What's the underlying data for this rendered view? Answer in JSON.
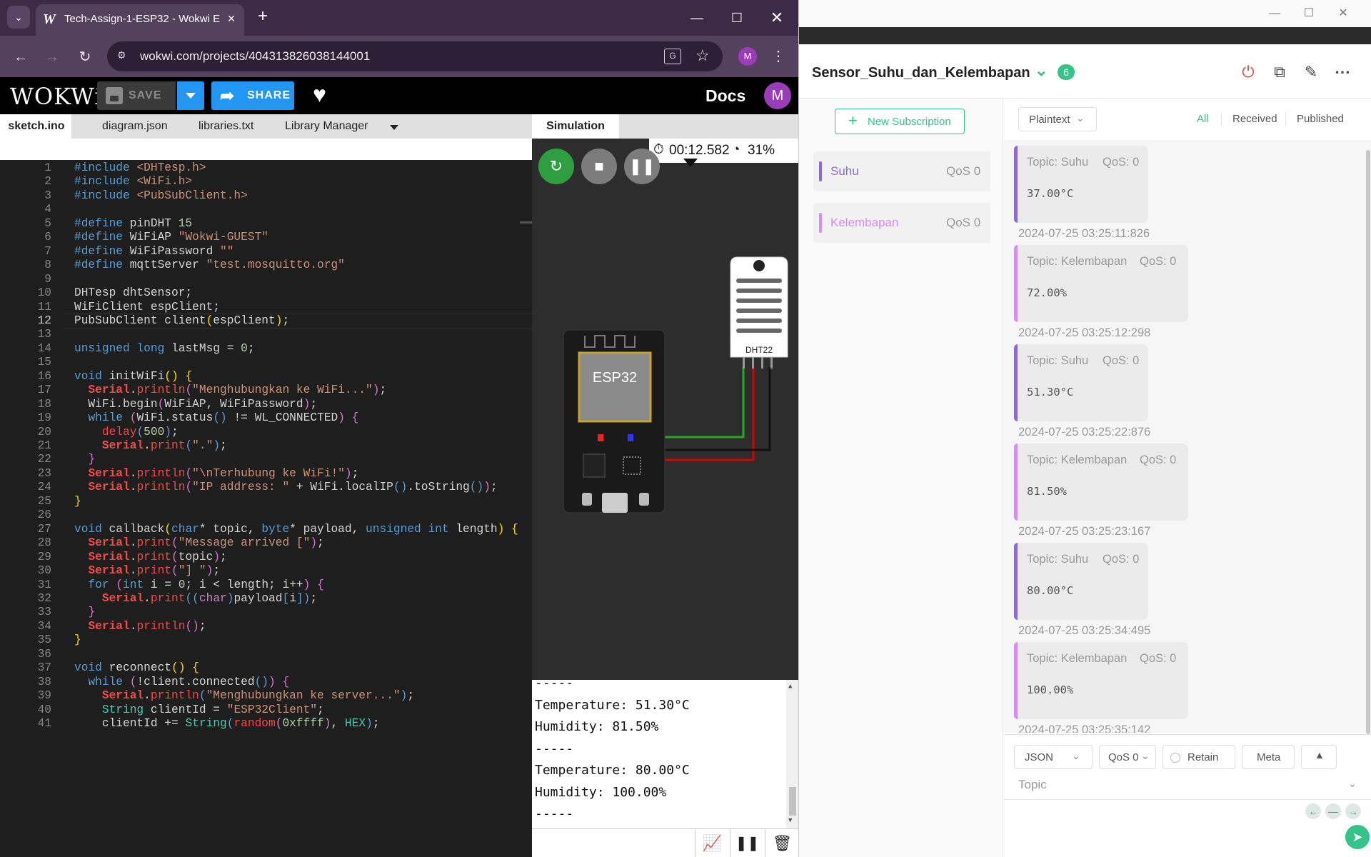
{
  "chrome": {
    "tab_title": "Tech-Assign-1-ESP32 - Wokwi E",
    "url": "wokwi.com/projects/404313826038144001",
    "profile_initial": "M"
  },
  "wokwi": {
    "logo": "WOKWi",
    "save_label": "SAVE",
    "share_label": "SHARE",
    "docs_label": "Docs",
    "avatar_initial": "M",
    "tabs": [
      "sketch.ino",
      "diagram.json",
      "libraries.txt",
      "Library Manager"
    ],
    "sim_tab": "Simulation",
    "timer": "00:12.582",
    "speed": "31%",
    "esp_label": "ESP32",
    "dht_label": "DHT22"
  },
  "code": {
    "current_line": 12,
    "lines": [
      "<span class=\"k\">#include</span> <span class=\"s\">&lt;DHTesp.h&gt;</span>",
      "<span class=\"k\">#include</span> <span class=\"s\">&lt;WiFi.h&gt;</span>",
      "<span class=\"k\">#include</span> <span class=\"s\">&lt;PubSubClient.h&gt;</span>",
      "",
      "<span class=\"k\">#define</span> pinDHT <span class=\"n\">15</span>",
      "<span class=\"k\">#define</span> WiFiAP <span class=\"s\">\"Wokwi-GUEST\"</span>",
      "<span class=\"k\">#define</span> WiFiPassword <span class=\"s\">\"\"</span>",
      "<span class=\"k\">#define</span> mqttServer <span class=\"s\">\"test.mosquitto.org\"</span>",
      "",
      "DHTesp dhtSensor;",
      "WiFiClient espClient;",
      "PubSubClient client<span class=\"y\">(</span>espClient<span class=\"y\">)</span>;",
      "",
      "<span class=\"k\">unsigned</span> <span class=\"k\">long</span> lastMsg = <span class=\"n\">0</span>;",
      "",
      "<span class=\"k\">void</span> initWiFi<span class=\"y\">()</span> <span class=\"y\">{</span>",
      "  <span class=\"sv\">Serial</span>.<span class=\"o\">println</span><span class=\"p\">(</span><span class=\"s\">\"Menghubungkan ke WiFi...\"</span><span class=\"p\">)</span>;",
      "  WiFi.begin<span class=\"p\">(</span>WiFiAP, WiFiPassword<span class=\"p\">)</span>;",
      "  <span class=\"k\">while</span> <span class=\"p\">(</span>WiFi.status<span class=\"k\">()</span> != WL_CONNECTED<span class=\"p\">)</span> <span class=\"p\">{</span>",
      "    <span class=\"o\">delay</span><span class=\"k\">(</span><span class=\"n\">500</span><span class=\"k\">)</span>;",
      "    <span class=\"sv\">Serial</span>.<span class=\"o\">print</span><span class=\"k\">(</span><span class=\"s\">\".\"</span><span class=\"k\">)</span>;",
      "  <span class=\"p\">}</span>",
      "  <span class=\"sv\">Serial</span>.<span class=\"o\">println</span><span class=\"p\">(</span><span class=\"s\">\"\\nTerhubung ke WiFi!\"</span><span class=\"p\">)</span>;",
      "  <span class=\"sv\">Serial</span>.<span class=\"o\">println</span><span class=\"p\">(</span><span class=\"s\">\"IP address: \"</span> + WiFi.localIP<span class=\"k\">()</span>.toString<span class=\"k\">()</span><span class=\"p\">)</span>;",
      "<span class=\"y\">}</span>",
      "",
      "<span class=\"k\">void</span> callback<span class=\"y\">(</span><span class=\"k\">char</span>* topic, <span class=\"k\">byte</span>* payload, <span class=\"k\">unsigned</span> <span class=\"k\">int</span> length<span class=\"y\">)</span> <span class=\"y\">{</span>",
      "  <span class=\"sv\">Serial</span>.<span class=\"o\">print</span><span class=\"p\">(</span><span class=\"s\">\"Message arrived [\"</span><span class=\"p\">)</span>;",
      "  <span class=\"sv\">Serial</span>.<span class=\"o\">print</span><span class=\"p\">(</span>topic<span class=\"p\">)</span>;",
      "  <span class=\"sv\">Serial</span>.<span class=\"o\">print</span><span class=\"p\">(</span><span class=\"s\">\"] \"</span><span class=\"p\">)</span>;",
      "  <span class=\"k\">for</span> <span class=\"p\">(</span><span class=\"k\">int</span> i = <span class=\"n\">0</span>; i &lt; length; i++<span class=\"p\">)</span> <span class=\"p\">{</span>",
      "    <span class=\"sv\">Serial</span>.<span class=\"o\">print</span><span class=\"k\">((</span><span class=\"c\">char</span><span class=\"k\">)</span>payload<span class=\"k\">[</span>i<span class=\"k\">])</span>;",
      "  <span class=\"p\">}</span>",
      "  <span class=\"sv\">Serial</span>.<span class=\"o\">println</span><span class=\"p\">()</span>;",
      "<span class=\"y\">}</span>",
      "",
      "<span class=\"k\">void</span> reconnect<span class=\"y\">()</span> <span class=\"y\">{</span>",
      "  <span class=\"k\">while</span> <span class=\"p\">(</span>!client.connected<span class=\"k\">()</span><span class=\"p\">)</span> <span class=\"p\">{</span>",
      "    <span class=\"sv\">Serial</span>.<span class=\"o\">println</span><span class=\"k\">(</span><span class=\"s\">\"Menghubungkan ke server...\"</span><span class=\"k\">)</span>;",
      "    <span class=\"t\">String</span> clientId = <span class=\"s\">\"ESP32Client\"</span>;",
      "    clientId += <span class=\"t\">String</span><span class=\"k\">(</span><span class=\"o\">random</span><span class=\"c\">(</span><span class=\"n\">0xffff</span><span class=\"c\">)</span>, <span class=\"t\">HEX</span><span class=\"k\">)</span>;"
    ]
  },
  "serial": {
    "lines": [
      "-----",
      "Temperature: 51.30°C",
      "Humidity: 81.50%",
      "-----",
      "Temperature: 80.00°C",
      "Humidity: 100.00%",
      "-----"
    ]
  },
  "mqttx": {
    "connection_name": "Sensor_Suhu_dan_Kelembapan",
    "connection_badge": "6",
    "new_subscription": "New Subscription",
    "subscriptions": [
      {
        "name": "Suhu",
        "qos": "QoS 0",
        "color": "#8c6ad1"
      },
      {
        "name": "Kelembapan",
        "qos": "QoS 0",
        "color": "#d38ef0"
      }
    ],
    "payload_type": "Plaintext",
    "filters": [
      "All",
      "Received",
      "Published"
    ],
    "messages": [
      {
        "topic": "Topic: Suhu",
        "qos": "QoS: 0",
        "payload": "37.00°C",
        "time": "2024-07-25 03:25:11:826",
        "color": "#8c6ad1"
      },
      {
        "topic": "Topic: Kelembapan",
        "qos": "QoS: 0",
        "payload": "72.00%",
        "time": "2024-07-25 03:25:12:298",
        "color": "#d38ef0"
      },
      {
        "topic": "Topic: Suhu",
        "qos": "QoS: 0",
        "payload": "51.30°C",
        "time": "2024-07-25 03:25:22:876",
        "color": "#8c6ad1"
      },
      {
        "topic": "Topic: Kelembapan",
        "qos": "QoS: 0",
        "payload": "81.50%",
        "time": "2024-07-25 03:25:23:167",
        "color": "#d38ef0"
      },
      {
        "topic": "Topic: Suhu",
        "qos": "QoS: 0",
        "payload": "80.00°C",
        "time": "2024-07-25 03:25:34:495",
        "color": "#8c6ad1"
      },
      {
        "topic": "Topic: Kelembapan",
        "qos": "QoS: 0",
        "payload": "100.00%",
        "time": "2024-07-25 03:25:35:142",
        "color": "#d38ef0"
      }
    ],
    "composer": {
      "format": "JSON",
      "qos": "QoS 0",
      "retain": "Retain",
      "meta": "Meta",
      "topic_placeholder": "Topic"
    }
  }
}
